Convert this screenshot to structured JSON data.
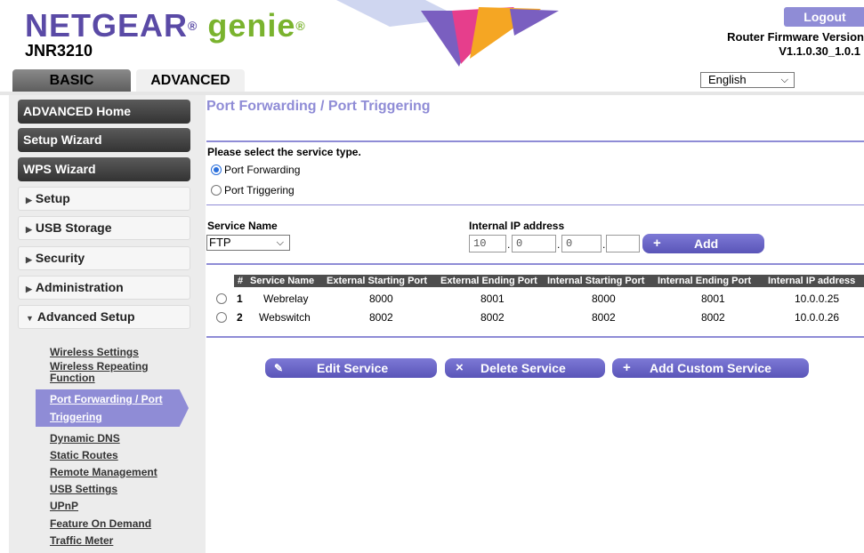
{
  "header": {
    "logo_netgear": "NETGEAR",
    "logo_reg": "®",
    "logo_genie": "genie",
    "logo_reg2": "®",
    "model": "JNR3210",
    "logout": "Logout",
    "fw_label": "Router Firmware Version",
    "fw_value": "V1.1.0.30_1.0.1"
  },
  "tabs": {
    "basic": "BASIC",
    "advanced": "ADVANCED"
  },
  "language": {
    "selected": "English"
  },
  "sidebar": {
    "advanced_home": "ADVANCED Home",
    "setup_wizard": "Setup Wizard",
    "wps_wizard": "WPS Wizard",
    "setup": "Setup",
    "usb_storage": "USB Storage",
    "security": "Security",
    "administration": "Administration",
    "advanced_setup": "Advanced Setup",
    "submenu": {
      "wireless_settings": "Wireless Settings",
      "wireless_repeating_1": "Wireless Repeating",
      "wireless_repeating_2": "Function",
      "port_forwarding_1": "Port Forwarding / Port",
      "port_forwarding_2": "Triggering",
      "dynamic_dns": "Dynamic DNS",
      "static_routes": "Static Routes",
      "remote_management": "Remote Management",
      "usb_settings": "USB Settings",
      "upnp": "UPnP",
      "feature_on_demand": "Feature On Demand",
      "traffic_meter": "Traffic Meter"
    }
  },
  "main": {
    "title": "Port Forwarding / Port Triggering",
    "select_prompt": "Please select the service type.",
    "radio_forwarding": "Port Forwarding",
    "radio_triggering": "Port Triggering",
    "service_name_label": "Service Name",
    "service_name_value": "FTP",
    "internal_ip_label": "Internal IP address",
    "ip1": "10",
    "ip2": "0",
    "ip3": "0",
    "ip4": "",
    "add": "Add",
    "table": {
      "headers": [
        "#",
        "Service Name",
        "External Starting Port",
        "External Ending Port",
        "Internal Starting Port",
        "Internal Ending Port",
        "Internal IP address"
      ],
      "rows": [
        [
          "1",
          "Webrelay",
          "8000",
          "8001",
          "8000",
          "8001",
          "10.0.0.25"
        ],
        [
          "2",
          "Webswitch",
          "8002",
          "8002",
          "8002",
          "8002",
          "10.0.0.26"
        ]
      ]
    },
    "edit_service": "Edit Service",
    "delete_service": "Delete Service",
    "add_custom_service": "Add Custom Service"
  },
  "colors": {
    "accent": "#8f8cd6",
    "button": "#6a66c9",
    "logo_purple": "#5a4aa6",
    "logo_green": "#7ab32e"
  }
}
